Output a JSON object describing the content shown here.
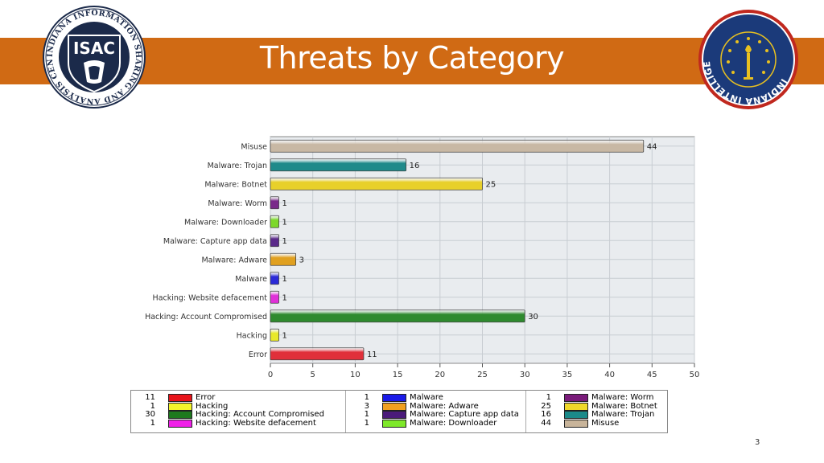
{
  "slide": {
    "title": "Threats by Category",
    "page_number": "3",
    "banner_color": "#d06a14"
  },
  "logos": {
    "left": {
      "badge_text": "ISAC",
      "ring_text": "INDIANA INFORMATION SHARING AND ANALYSIS CENTER"
    },
    "right": {
      "ring_text": "INDIANA INTELLIGENCE FUSION CENTER"
    }
  },
  "chart_data": {
    "type": "bar",
    "orientation": "horizontal",
    "categories": [
      "Misuse",
      "Malware: Trojan",
      "Malware: Botnet",
      "Malware: Worm",
      "Malware: Downloader",
      "Malware: Capture app data",
      "Malware: Adware",
      "Malware",
      "Hacking: Website defacement",
      "Hacking: Account Compromised",
      "Hacking",
      "Error"
    ],
    "values": [
      44,
      16,
      25,
      1,
      1,
      1,
      3,
      1,
      1,
      30,
      1,
      11
    ],
    "colors": [
      "#c8b8a4",
      "#1f8a8a",
      "#e8d02a",
      "#7a2a8a",
      "#7cd82a",
      "#5a2a8a",
      "#e0a020",
      "#2a2ad8",
      "#e030d8",
      "#2e8a2e",
      "#e8e82a",
      "#e0303a"
    ],
    "xlim": [
      0,
      50
    ],
    "xticks": [
      0,
      5,
      10,
      15,
      20,
      25,
      30,
      35,
      40,
      45,
      50
    ],
    "grid": true,
    "legend": [
      {
        "count": "11",
        "label": "Error",
        "color": "#e8141a"
      },
      {
        "count": "1",
        "label": "Hacking",
        "color": "#f5f52a"
      },
      {
        "count": "30",
        "label": "Hacking: Account Compromised",
        "color": "#1e7a1e"
      },
      {
        "count": "1",
        "label": "Hacking: Website defacement",
        "color": "#f020e8"
      },
      {
        "count": "1",
        "label": "Malware",
        "color": "#1a1ae8"
      },
      {
        "count": "3",
        "label": "Malware: Adware",
        "color": "#f0a020"
      },
      {
        "count": "1",
        "label": "Malware: Capture app data",
        "color": "#4a1a7a"
      },
      {
        "count": "1",
        "label": "Malware: Downloader",
        "color": "#7ee82a"
      },
      {
        "count": "1",
        "label": "Malware: Worm",
        "color": "#7a1a7a"
      },
      {
        "count": "25",
        "label": "Malware: Botnet",
        "color": "#f0d82a"
      },
      {
        "count": "16",
        "label": "Malware: Trojan",
        "color": "#1a8a8a"
      },
      {
        "count": "44",
        "label": "Misuse",
        "color": "#c8b49a"
      }
    ]
  }
}
